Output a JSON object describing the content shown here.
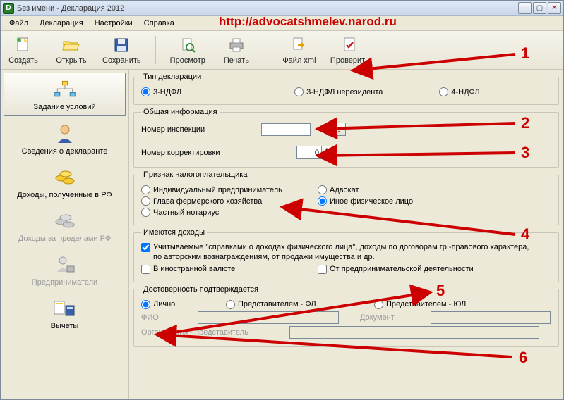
{
  "window": {
    "title": "Без имени - Декларация 2012",
    "app_initial": "D"
  },
  "url_overlay": "http://advocatshmelev.narod.ru",
  "menu": {
    "file": "Файл",
    "declaration": "Декларация",
    "settings": "Настройки",
    "help": "Справка"
  },
  "toolbar": {
    "create": "Создать",
    "open": "Открыть",
    "save": "Сохранить",
    "preview": "Просмотр",
    "print": "Печать",
    "filexml": "Файл xml",
    "check": "Проверить"
  },
  "sidebar": {
    "items": [
      {
        "label": "Задание условий"
      },
      {
        "label": "Сведения о декларанте"
      },
      {
        "label": "Доходы, полученные в РФ"
      },
      {
        "label": "Доходы за пределами РФ"
      },
      {
        "label": "Предприниматели"
      },
      {
        "label": "Вычеты"
      }
    ]
  },
  "sections": {
    "decl_type": {
      "legend": "Тип декларации",
      "opt1": "3-НДФЛ",
      "opt2": "3-НДФЛ нерезидента",
      "opt3": "4-НДФЛ"
    },
    "general": {
      "legend": "Общая информация",
      "inspection_label": "Номер инспекции",
      "inspection_value": "",
      "inspection_btn": "...",
      "correction_label": "Номер корректировки",
      "correction_value": "0"
    },
    "taxpayer": {
      "legend": "Признак налогоплательщика",
      "opt1": "Индивидуальный предприниматель",
      "opt2": "Адвокат",
      "opt3": "Глава фермерского хозяйства",
      "opt4": "Иное физическое лицо",
      "opt5": "Частный нотариус"
    },
    "income": {
      "legend": "Имеются доходы",
      "chk1": "Учитываемые \"справками о доходах физического лица\", доходы по договорам гр.-правового характера, по авторским вознаграждениям, от продажи имущества и др.",
      "chk2": "В иностранной валюте",
      "chk3": "От предпринимательской деятельности"
    },
    "trust": {
      "legend": "Достоверность подтверждается",
      "opt1": "Лично",
      "opt2": "Представителем - ФЛ",
      "opt3": "Представителем - ЮЛ",
      "fio_label": "ФИО",
      "doc_label": "Документ",
      "org_label": "Организация - представитель"
    }
  },
  "annotations": {
    "n1": "1",
    "n2": "2",
    "n3": "3",
    "n4": "4",
    "n5": "5",
    "n6": "6"
  }
}
